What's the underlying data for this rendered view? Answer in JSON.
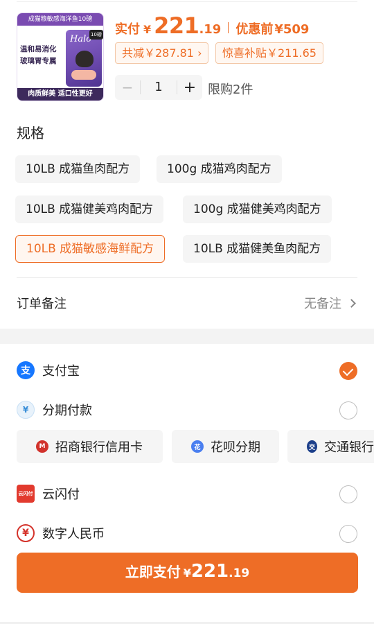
{
  "product": {
    "banner_text": "成猫粮敏感海洋鱼10磅",
    "image_caption": "温和易消化\n玻璃胃专属",
    "brand": "Halo",
    "bag_badge": "10磅",
    "footer_text": "肉质鲜美 适口性更好"
  },
  "price": {
    "actual_label": "实付",
    "currency": "¥",
    "actual_int": "221",
    "actual_dec": ".19",
    "original_label": "优惠前",
    "original_value": "¥509",
    "total_discount": "共减￥287.81 ›",
    "subsidy": "惊喜补贴￥211.65"
  },
  "quantity": {
    "minus": "−",
    "value": "1",
    "plus": "+",
    "limit": "限购2件"
  },
  "specs": {
    "title": "规格",
    "options": [
      {
        "label": "10LB 成猫鱼肉配方",
        "selected": false
      },
      {
        "label": "100g 成猫鸡肉配方",
        "selected": false
      },
      {
        "label": "10LB 成猫健美鸡肉配方",
        "selected": false
      },
      {
        "label": "100g 成猫健美鸡肉配方",
        "selected": false
      },
      {
        "label": "10LB 成猫敏感海鲜配方",
        "selected": true
      },
      {
        "label": "10LB 成猫健美鱼肉配方",
        "selected": false
      }
    ]
  },
  "remark": {
    "label": "订单备注",
    "value": "无备注"
  },
  "payment": {
    "methods": [
      {
        "label": "支付宝",
        "icon": "alipay-icon",
        "glyph": "支",
        "checked": true
      },
      {
        "label": "分期付款",
        "icon": "installment-icon",
        "glyph": "¥",
        "checked": false
      },
      {
        "label": "云闪付",
        "icon": "unionpay-icon",
        "glyph": "云闪付",
        "checked": false
      },
      {
        "label": "数字人民币",
        "icon": "ecny-icon",
        "glyph": "¥",
        "checked": false
      }
    ],
    "banks": [
      {
        "label": "招商银行信用卡",
        "icon": "cmb-icon",
        "color": "#d1322c",
        "glyph": "M"
      },
      {
        "label": "花呗分期",
        "icon": "huabei-icon",
        "color": "#4a7ff0",
        "glyph": "花"
      },
      {
        "label": "交通银行",
        "icon": "bocom-icon",
        "color": "#1c3f8a",
        "glyph": "交"
      }
    ]
  },
  "pay_button": {
    "label": "立即支付",
    "currency": "¥",
    "int": "221",
    "dec": ".19"
  },
  "colors": {
    "accent": "#ee6d26",
    "alipay": "#1677ff"
  }
}
